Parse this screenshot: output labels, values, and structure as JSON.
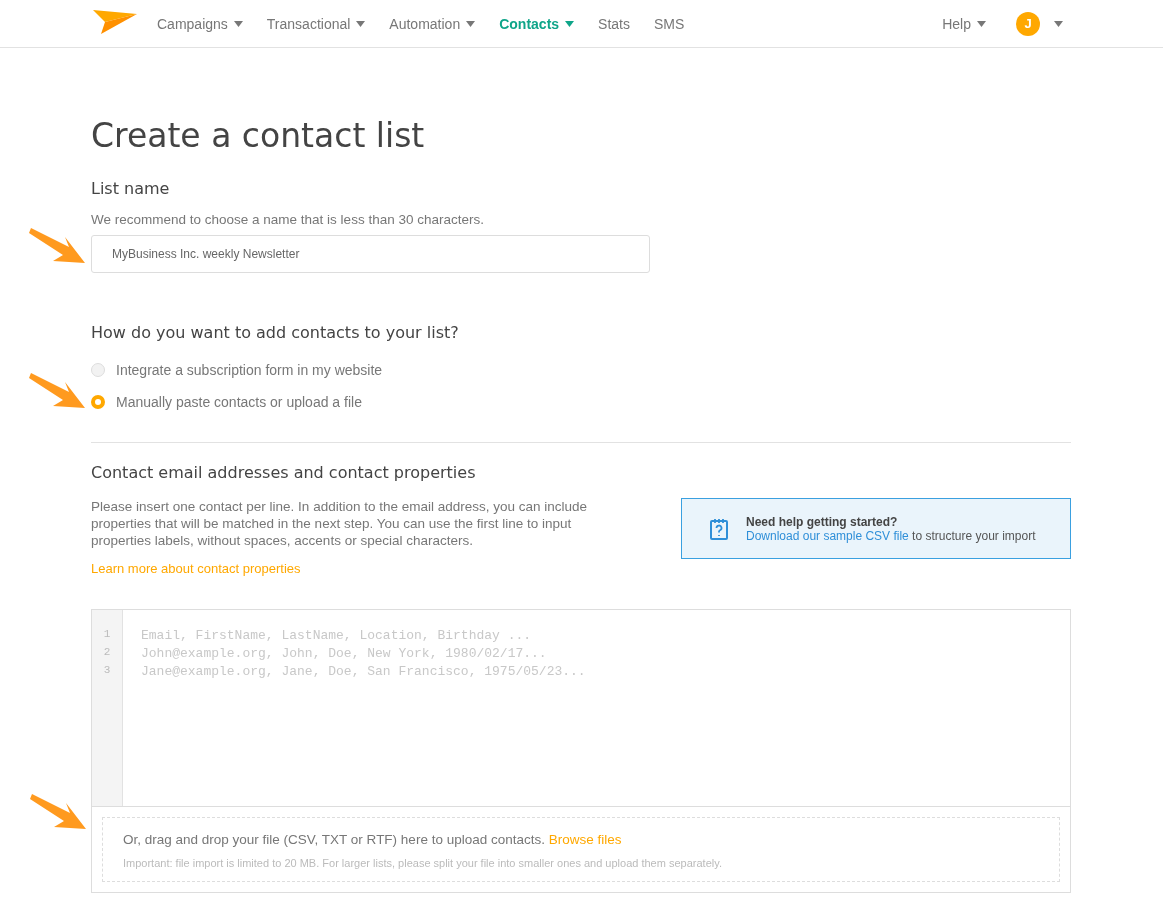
{
  "nav": {
    "items": [
      {
        "label": "Campaigns",
        "dropdown": true,
        "selected": false
      },
      {
        "label": "Transactional",
        "dropdown": true,
        "selected": false
      },
      {
        "label": "Automation",
        "dropdown": true,
        "selected": false
      },
      {
        "label": "Contacts",
        "dropdown": true,
        "selected": true
      },
      {
        "label": "Stats",
        "dropdown": false,
        "selected": false
      },
      {
        "label": "SMS",
        "dropdown": false,
        "selected": false
      }
    ],
    "help": "Help",
    "avatar": "J"
  },
  "title": "Create a contact list",
  "list_name": {
    "label": "List name",
    "hint": "We recommend to choose a name that is less than 30 characters.",
    "value": "MyBusiness Inc. weekly Newsletter"
  },
  "method": {
    "question": "How do you want to add contacts to your list?",
    "options": [
      {
        "label": "Integrate a subscription form in my website",
        "selected": false
      },
      {
        "label": "Manually paste contacts or upload a file",
        "selected": true
      }
    ]
  },
  "contacts": {
    "heading": "Contact email addresses and contact properties",
    "description": "Please insert one contact per line. In addition to the email address, you can include properties that will be matched in the next step. You can use the first line to input properties labels, without spaces, accents or special characters.",
    "learn_more": "Learn more about contact properties",
    "help_box": {
      "title": "Need help getting started?",
      "link": "Download our sample CSV file",
      "text": "to structure your import"
    }
  },
  "editor": {
    "lines": [
      {
        "number": "1",
        "placeholder": "Email, FirstName, LastName, Location, Birthday ..."
      },
      {
        "number": "2",
        "placeholder": "John@example.org, John, Doe, New York, 1980/02/17..."
      },
      {
        "number": "3",
        "placeholder": "Jane@example.org, Jane, Doe, San Francisco, 1975/05/23..."
      }
    ]
  },
  "upload": {
    "text": "Or, drag and drop your file (CSV, TXT or RTF) here to upload contacts.",
    "link": "Browse files",
    "note": "Important: file import is limited to 20 MB. For larger lists, please split your file into smaller ones and upload them separately."
  }
}
